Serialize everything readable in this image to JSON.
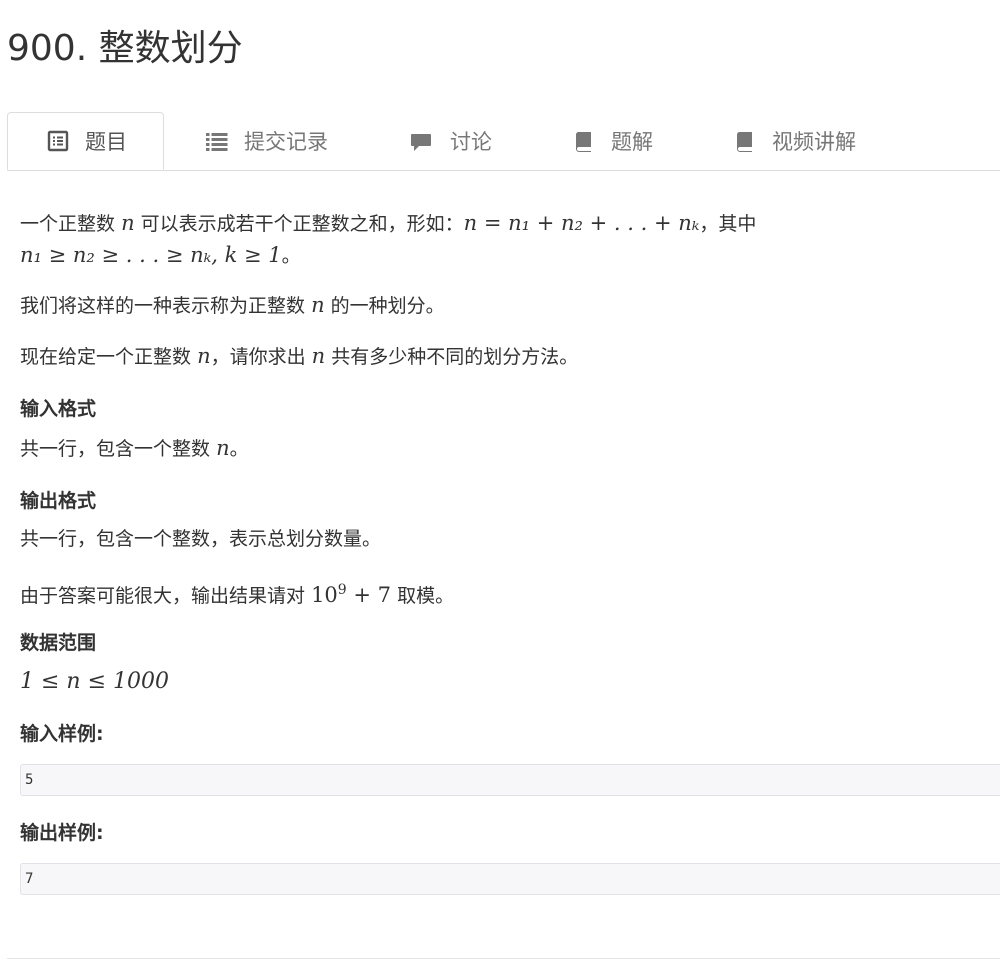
{
  "page": {
    "title": "900. 整数划分"
  },
  "tabs": [
    {
      "label": "题目",
      "icon": "document-icon",
      "active": true
    },
    {
      "label": "提交记录",
      "icon": "list-icon",
      "active": false
    },
    {
      "label": "讨论",
      "icon": "comment-icon",
      "active": false
    },
    {
      "label": "题解",
      "icon": "book-icon",
      "active": false
    },
    {
      "label": "视频讲解",
      "icon": "book-icon",
      "active": false
    }
  ],
  "problem": {
    "intro_text": "一个正整数",
    "intro_var": "n",
    "intro_text2": "可以表示成若干个正整数之和，形如：",
    "intro_formula": "n = n₁ + n₂ + . . . + nₖ",
    "intro_text3": "，其中",
    "intro_formula2": "n₁ ≥ n₂ ≥ . . . ≥ nₖ, k ≥ 1",
    "intro_end": "。",
    "para2_a": "我们将这样的一种表示称为正整数",
    "para2_var": "n",
    "para2_b": "的一种划分。",
    "para3_a": "现在给定一个正整数",
    "para3_var": "n",
    "para3_b": "，请你求出",
    "para3_var2": "n",
    "para3_c": "共有多少种不同的划分方法。",
    "input_format_heading": "输入格式",
    "input_format_a": "共一行，包含一个整数",
    "input_format_var": "n",
    "input_format_b": "。",
    "output_format_heading": "输出格式",
    "output_format": "共一行，包含一个整数，表示总划分数量。",
    "mod_a": "由于答案可能很大，输出结果请对",
    "mod_base": "10",
    "mod_exp": "9",
    "mod_plus": "+ 7",
    "mod_b": "取模。",
    "range_heading": "数据范围",
    "range_formula": "1 ≤ n ≤ 1000",
    "sample_input_heading": "输入样例:",
    "sample_input": "5",
    "sample_output_heading": "输出样例:",
    "sample_output": "7"
  }
}
